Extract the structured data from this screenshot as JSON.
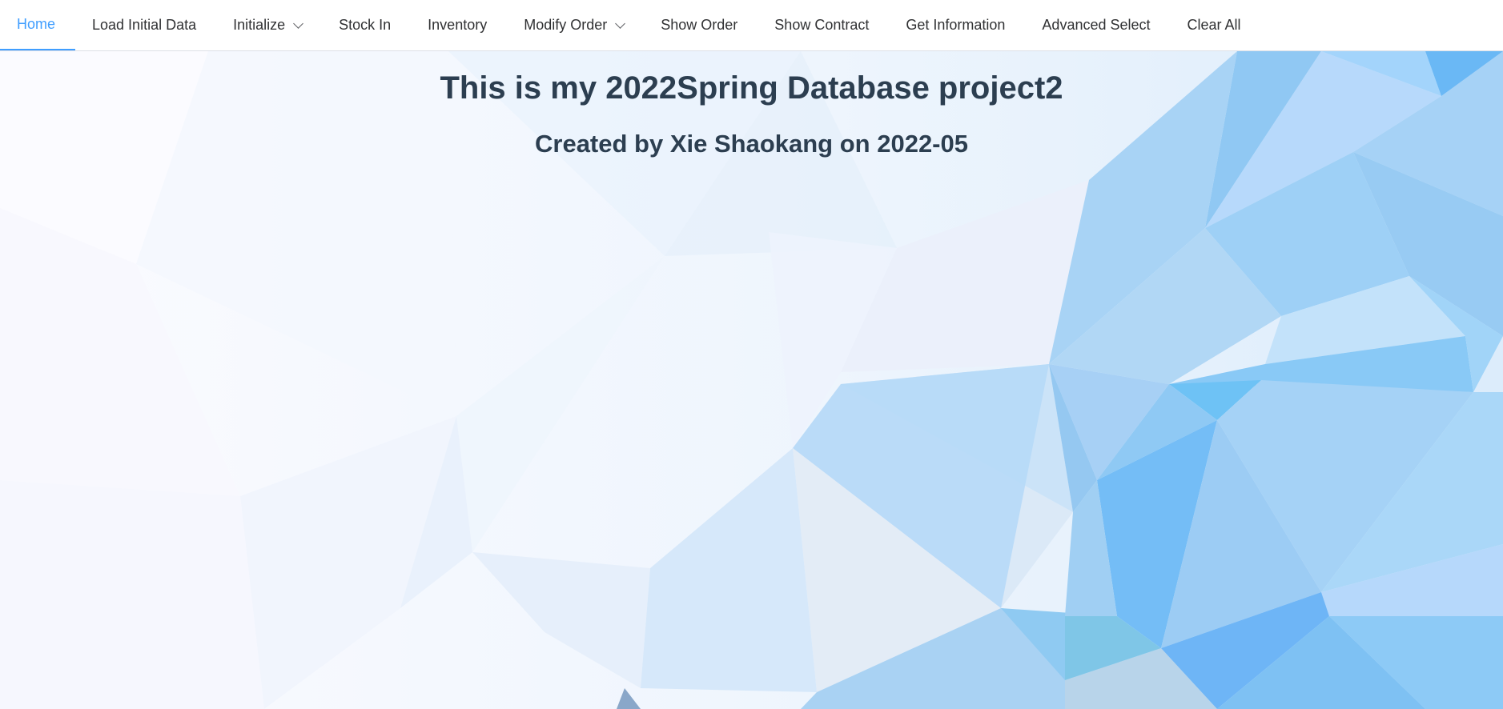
{
  "nav": {
    "items": [
      {
        "label": "Home",
        "active": true,
        "has_dropdown": false
      },
      {
        "label": "Load Initial Data",
        "active": false,
        "has_dropdown": false
      },
      {
        "label": "Initialize",
        "active": false,
        "has_dropdown": true
      },
      {
        "label": "Stock In",
        "active": false,
        "has_dropdown": false
      },
      {
        "label": "Inventory",
        "active": false,
        "has_dropdown": false
      },
      {
        "label": "Modify Order",
        "active": false,
        "has_dropdown": true
      },
      {
        "label": "Show Order",
        "active": false,
        "has_dropdown": false
      },
      {
        "label": "Show Contract",
        "active": false,
        "has_dropdown": false
      },
      {
        "label": "Get Information",
        "active": false,
        "has_dropdown": false
      },
      {
        "label": "Advanced Select",
        "active": false,
        "has_dropdown": false
      },
      {
        "label": "Clear All",
        "active": false,
        "has_dropdown": false
      }
    ]
  },
  "main": {
    "title": "This is my 2022Spring Database project2",
    "subtitle": "Created by Xie Shaokang on 2022-05"
  },
  "colors": {
    "accent": "#409eff",
    "heading": "#2c3e50",
    "nav_text": "#303133"
  }
}
